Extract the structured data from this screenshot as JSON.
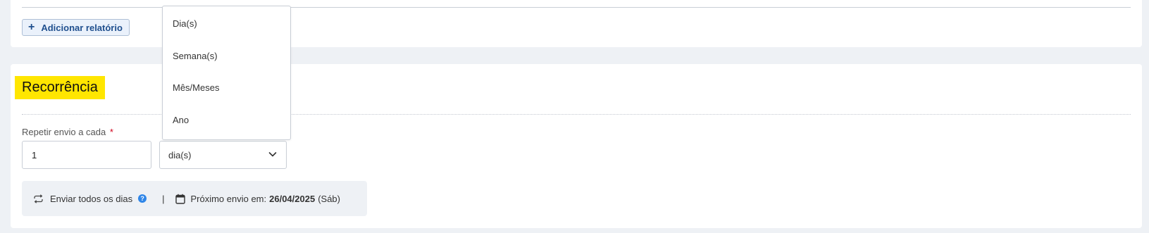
{
  "reports": {
    "add_button_label": "Adicionar relatório",
    "add_button_icon": "plus-icon"
  },
  "recurrence": {
    "title": "Recorrência",
    "title_highlight_color": "#ffe600",
    "repeat_label": "Repetir envio a cada",
    "required_marker": "*",
    "interval_value": "1",
    "unit_selected": "dia(s)",
    "unit_options": [
      "Dia(s)",
      "Semana(s)",
      "Mês/Meses",
      "Ano"
    ],
    "summary": {
      "frequency_text": "Enviar todos os dias",
      "frequency_icon": "repeat-icon",
      "help_icon": "help-icon",
      "separator": "|",
      "calendar_icon": "calendar-icon",
      "next_label": "Próximo envio em:",
      "next_date": "26/04/2025",
      "next_weekday": "(Sáb)"
    }
  }
}
